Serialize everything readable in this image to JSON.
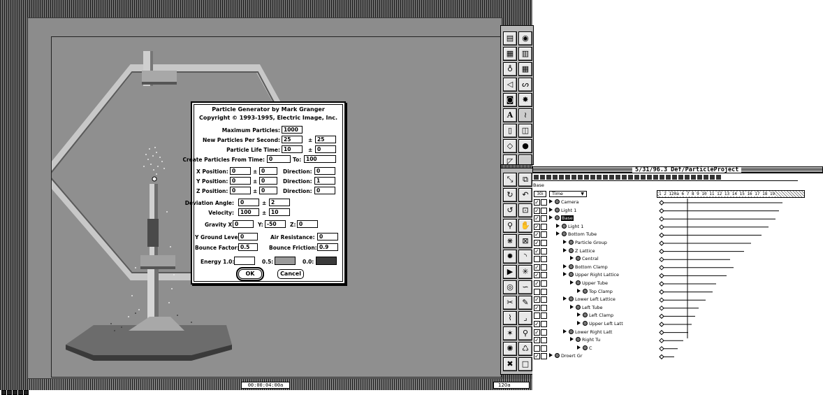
{
  "viewport": {
    "time_display": "00:00:04:00a",
    "frame_display": "120a"
  },
  "dialog": {
    "title_line1": "Particle Generator by Mark Granger",
    "title_line2": "Copyright © 1993-1995, Electric Image, Inc.",
    "max_particles_label": "Maximum Particles:",
    "max_particles_value": "1000",
    "new_particles_label": "New Particles Per Second:",
    "new_particles_value": "25",
    "new_particles_var": "25",
    "life_time_label": "Particle Life Time:",
    "life_time_value": "10",
    "life_time_var": "0",
    "create_from_label": "Create Particles From Time:",
    "create_from_value": "0",
    "to_label": "To:",
    "create_to_value": "100",
    "x_position_label": "X Position:",
    "x_position_value": "0",
    "x_position_var": "0",
    "x_direction_label": "Direction:",
    "x_direction_value": "0",
    "y_position_label": "Y Position:",
    "y_position_value": "0",
    "y_position_var": "0",
    "y_direction_label": "Direction:",
    "y_direction_value": "1",
    "z_position_label": "Z Position:",
    "z_position_value": "0",
    "z_position_var": "0",
    "z_direction_label": "Direction:",
    "z_direction_value": "0",
    "deviation_label": "Deviation Angle:",
    "deviation_value": "0",
    "deviation_var": "2",
    "velocity_label": "Velocity:",
    "velocity_value": "100",
    "velocity_var": "10",
    "gravity_x_label": "Gravity X:",
    "gravity_x_value": "0",
    "gravity_y_label": "Y:",
    "gravity_y_value": "-50",
    "gravity_z_label": "Z:",
    "gravity_z_value": "0",
    "ground_label": "Y Ground Level:",
    "ground_value": "0",
    "air_label": "Air Resistance:",
    "air_value": "0",
    "bounce_label": "Bounce Factor:",
    "bounce_value": "0.5",
    "friction_label": "Bounce Friction:",
    "friction_value": "0.9",
    "energy_label": "Energy 1.0:",
    "energy_mid_label": "0.5:",
    "energy_zero_label": "0.0:",
    "energy_colors": [
      "#ffffff",
      "#9a9a9a",
      "#3a3a3a"
    ],
    "pm": "±",
    "ok_label": "OK",
    "cancel_label": "Cancel"
  },
  "tool_palette": {
    "text_tool_glyph": "A"
  },
  "project": {
    "title": "5/31/96.3 Def/ParticleProject",
    "name": "Base",
    "fps": "30i",
    "time_column": "Time",
    "ruler_labels": "1 2 120a 6 7 8 9 10 11 12 13 14 15 16 17 18 19",
    "current_frame": "120a",
    "check": "✓",
    "rows": [
      {
        "label": "Camera",
        "indent": 0,
        "icon": "camera-icon",
        "checked": true,
        "selected": false
      },
      {
        "label": "Light 1",
        "indent": 0,
        "icon": "light-icon",
        "checked": true,
        "selected": false
      },
      {
        "label": "Base",
        "indent": 0,
        "icon": "object-icon",
        "checked": true,
        "selected": true
      },
      {
        "label": "Light 1",
        "indent": 1,
        "icon": "light-icon",
        "checked": true,
        "selected": false
      },
      {
        "label": "Bottom Tube",
        "indent": 1,
        "icon": "object-icon",
        "checked": true,
        "selected": false
      },
      {
        "label": "Particle Group",
        "indent": 2,
        "icon": "object-icon",
        "checked": true,
        "selected": false
      },
      {
        "label": "Z Lattice",
        "indent": 2,
        "icon": "object-icon",
        "checked": true,
        "selected": false
      },
      {
        "label": "Central",
        "indent": 3,
        "icon": "object-icon",
        "checked": false,
        "selected": false
      },
      {
        "label": "Bottom Clamp",
        "indent": 2,
        "icon": "object-icon",
        "checked": true,
        "selected": false
      },
      {
        "label": "Upper Right Lattice",
        "indent": 2,
        "icon": "object-icon",
        "checked": true,
        "selected": false
      },
      {
        "label": "Upper Tube",
        "indent": 3,
        "icon": "object-icon",
        "checked": true,
        "selected": false
      },
      {
        "label": "Top Clamp",
        "indent": 4,
        "icon": "object-icon",
        "checked": false,
        "selected": false
      },
      {
        "label": "Lower Left Lattice",
        "indent": 2,
        "icon": "object-icon",
        "checked": true,
        "selected": false
      },
      {
        "label": "Left Tube",
        "indent": 3,
        "icon": "object-icon",
        "checked": true,
        "selected": false
      },
      {
        "label": "Left Clamp",
        "indent": 4,
        "icon": "object-icon",
        "checked": false,
        "selected": false
      },
      {
        "label": "Upper Left Latt",
        "indent": 4,
        "icon": "object-icon",
        "checked": true,
        "selected": false
      },
      {
        "label": "Lower Right Latt",
        "indent": 2,
        "icon": "object-icon",
        "checked": true,
        "selected": false
      },
      {
        "label": "Right Tu",
        "indent": 3,
        "icon": "object-icon",
        "checked": true,
        "selected": false
      },
      {
        "label": "C",
        "indent": 4,
        "icon": "object-icon",
        "checked": false,
        "selected": false
      },
      {
        "label": "Droert Gr",
        "indent": 0,
        "icon": "object-icon",
        "checked": true,
        "selected": false
      }
    ]
  }
}
